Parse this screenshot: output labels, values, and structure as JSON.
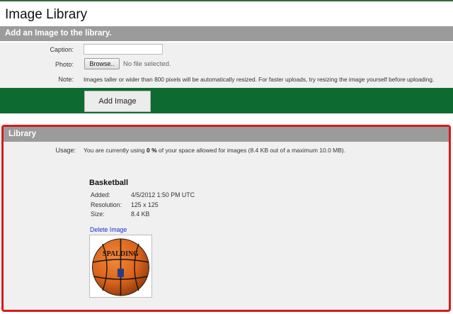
{
  "page": {
    "title": "Image Library"
  },
  "upload_section": {
    "header": "Add an Image to the library.",
    "caption_label": "Caption:",
    "caption_value": "",
    "photo_label": "Photo:",
    "browse_label": "Browse..",
    "file_status": "No file selected.",
    "note_label": "Note:",
    "note_text": "Images taller or wider than 800 pixels will be automatically resized. For faster uploads, try resizing the image yourself before uploading.",
    "submit_label": "Add Image"
  },
  "library_section": {
    "header": "Library",
    "usage_label": "Usage:",
    "usage_prefix": "You are currently using ",
    "usage_percent": "0 %",
    "usage_suffix": " of your space allowed for images (8.4 KB out of a maximum 10.0 MB).",
    "image": {
      "title": "Basketball",
      "added_label": "Added:",
      "added_value": "4/5/2012 1:50 PM UTC",
      "resolution_label": "Resolution:",
      "resolution_value": "125 x 125",
      "size_label": "Size:",
      "size_value": "8.4 KB",
      "delete_label": "Delete Image",
      "brand_text": "SPALDING"
    }
  },
  "colors": {
    "header_gray": "#9b9b9b",
    "panel_gray": "#f0f0f0",
    "green_band": "#0d6b31",
    "highlight_red": "#d71a1a",
    "link_blue": "#1a2fd0",
    "ball_orange": "#d9641c"
  }
}
